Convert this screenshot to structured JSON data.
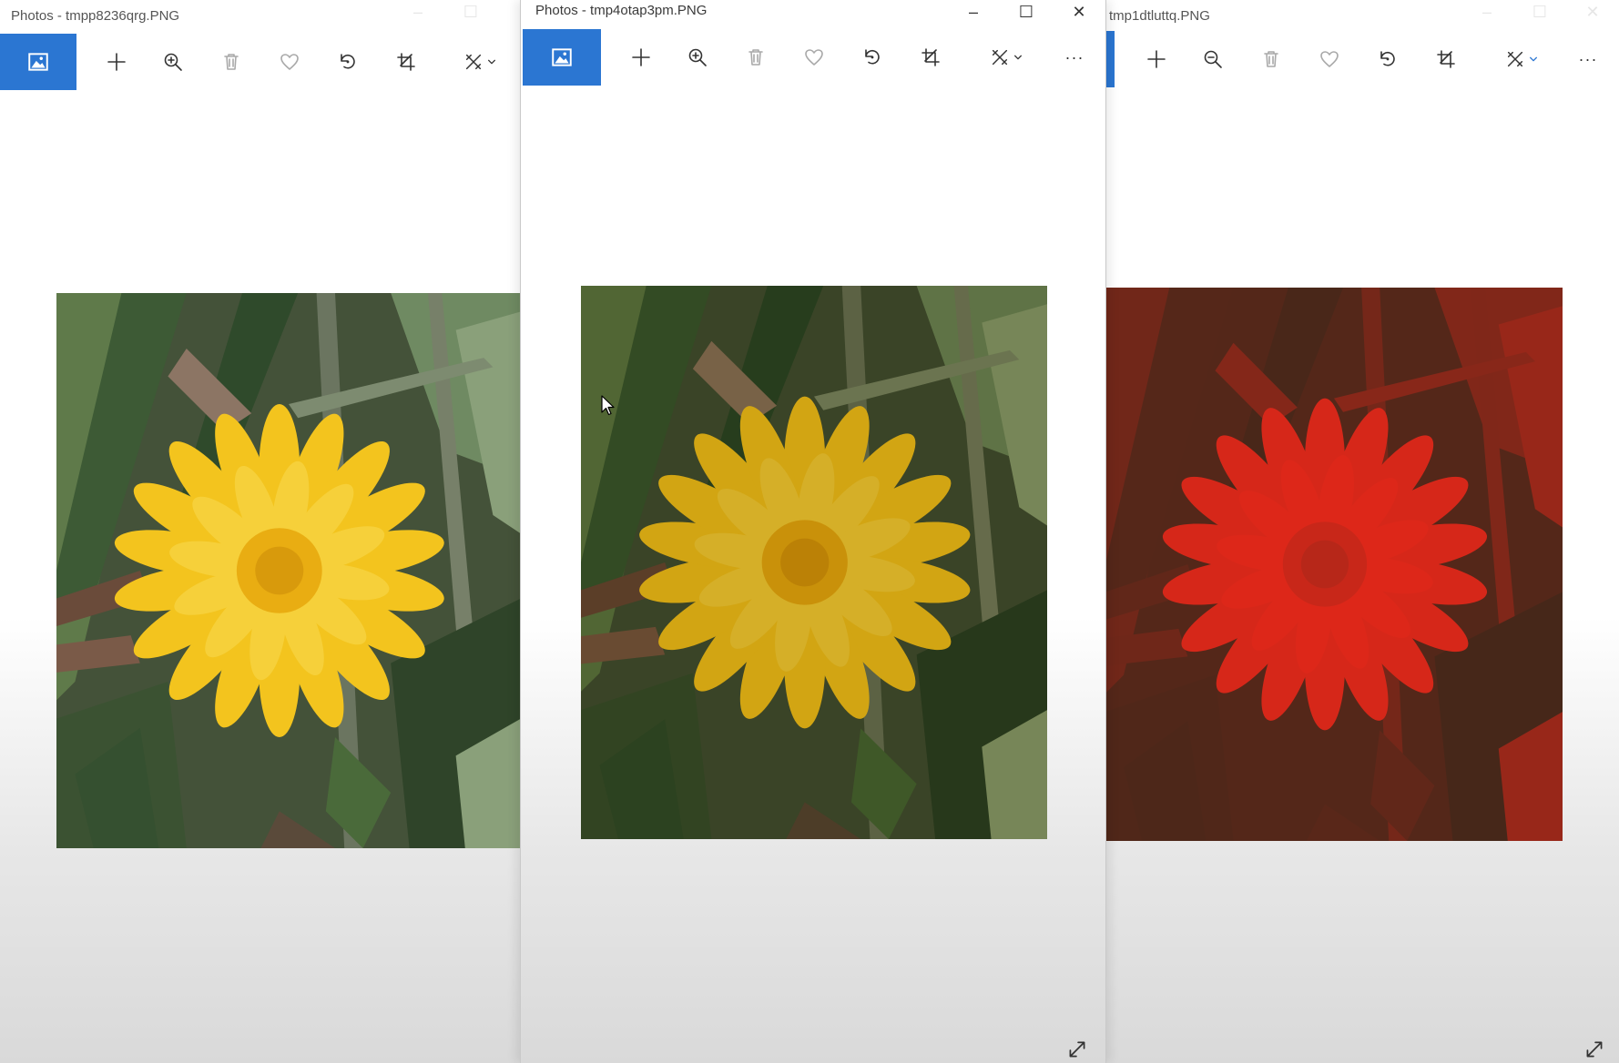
{
  "windows": [
    {
      "title": "Photos - tmpp8236qrg.PNG",
      "image": {
        "description_icon": "photo-filter-original",
        "filter": "original"
      }
    },
    {
      "title": "Photos - tmp4otap3pm.PNG",
      "window_controls": {
        "minimize": "–",
        "maximize": "☐",
        "close": "✕"
      },
      "image": {
        "filter": "darkened"
      }
    },
    {
      "title": "tmp1dtluttq.PNG",
      "image": {
        "filter": "red-channel"
      }
    }
  ],
  "toolbar": {
    "icons": [
      "photo-icon",
      "add-icon",
      "zoom-icon",
      "delete-icon",
      "favorite-icon",
      "rotate-icon",
      "crop-icon",
      "edit-icon",
      "chevron-down-icon",
      "more-icon"
    ],
    "more_label": "···"
  },
  "colors": {
    "accent": "#2b76d2",
    "icon": "#333333",
    "disabled_icon": "#a9a9a9"
  }
}
